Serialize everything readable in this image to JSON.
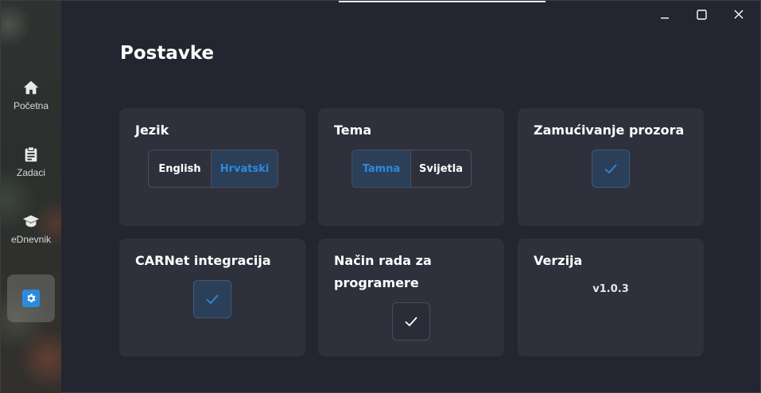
{
  "sidebar": {
    "items": [
      {
        "label": "Početna",
        "icon": "home-icon"
      },
      {
        "label": "Zadaci",
        "icon": "clipboard-icon"
      },
      {
        "label": "eDnevnik",
        "icon": "graduation-cap-icon"
      }
    ],
    "active_icon": "gear-icon"
  },
  "window_controls": {
    "minimize": "minimize-icon",
    "maximize": "maximize-icon",
    "close": "close-icon"
  },
  "page": {
    "title": "Postavke"
  },
  "settings": {
    "language": {
      "title": "Jezik",
      "options": [
        "English",
        "Hrvatski"
      ],
      "selected": "Hrvatski"
    },
    "theme": {
      "title": "Tema",
      "options": [
        "Tamna",
        "Svijetla"
      ],
      "selected": "Tamna"
    },
    "blur": {
      "title": "Zamućivanje prozora",
      "checked": true
    },
    "carnet": {
      "title": "CARNet integracija",
      "checked": true
    },
    "dev_mode": {
      "title": "Način rada za programere",
      "checked": false
    },
    "version": {
      "title": "Verzija",
      "value": "v1.0.3"
    }
  },
  "colors": {
    "accent": "#2b8ae0",
    "background": "#232530",
    "card": "#2e313c"
  }
}
